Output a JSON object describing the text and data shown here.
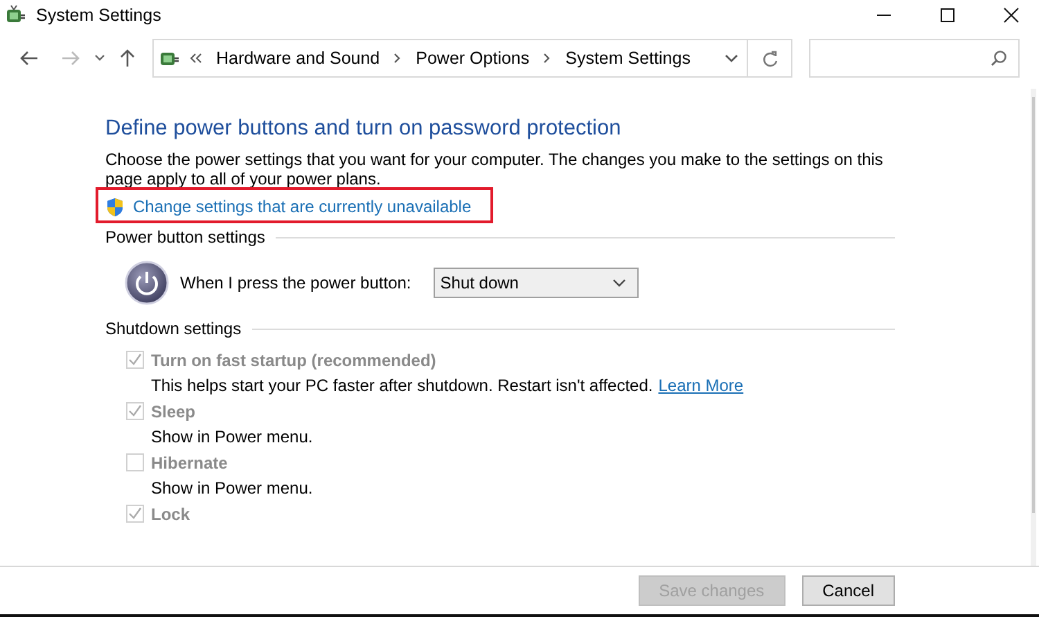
{
  "window": {
    "title": "System Settings"
  },
  "address_bar": {
    "path": [
      "Hardware and Sound",
      "Power Options",
      "System Settings"
    ]
  },
  "heading": "Define power buttons and turn on password protection",
  "description": "Choose the power settings that you want for your computer. The changes you make to the settings on this page apply to all of your power plans.",
  "admin_link": {
    "label": "Change settings that are currently unavailable",
    "highlighted": true
  },
  "power_button_section": {
    "title": "Power button settings",
    "label": "When I press the power button:",
    "value": "Shut down"
  },
  "shutdown_section": {
    "title": "Shutdown settings",
    "options": [
      {
        "label": "Turn on fast startup (recommended)",
        "checked": true,
        "disabled": true,
        "description": "This helps start your PC faster after shutdown. Restart isn't affected.",
        "link": "Learn More"
      },
      {
        "label": "Sleep",
        "checked": true,
        "disabled": true,
        "description": "Show in Power menu."
      },
      {
        "label": "Hibernate",
        "checked": false,
        "disabled": true,
        "description": "Show in Power menu."
      },
      {
        "label": "Lock",
        "checked": true,
        "disabled": true
      }
    ]
  },
  "buttons": [
    {
      "label": "Save changes",
      "disabled": true
    },
    {
      "label": "Cancel",
      "disabled": false
    }
  ]
}
